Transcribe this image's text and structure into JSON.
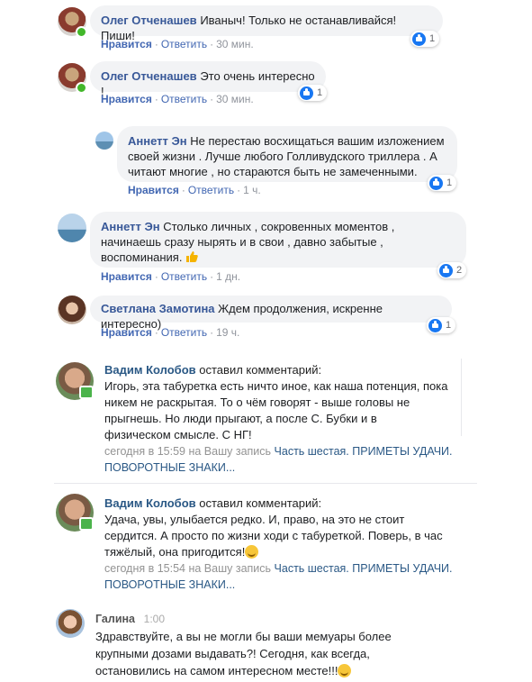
{
  "comments": [
    {
      "author": "Олег Отченашев",
      "text": "Иваныч! Только не останавливайся! Пиши!",
      "like_label": "Нравится",
      "reply_label": "Ответить",
      "time": "30 мин.",
      "likes": "1"
    },
    {
      "author": "Олег Отченашев",
      "text": "Это очень интересно !",
      "like_label": "Нравится",
      "reply_label": "Ответить",
      "time": "30 мин.",
      "likes": "1"
    },
    {
      "author": "Аннетт Эн",
      "line1": "Не перестаю восхищаться вашим изложением",
      "line2": "своей жизни . Лучше любого Голливудского триллера . А",
      "line3": "читают многие , но стараются быть не замеченными.",
      "like_label": "Нравится",
      "reply_label": "Ответить",
      "time": "1 ч.",
      "likes": "1"
    },
    {
      "author": "Аннетт Эн",
      "line1": "Столько личных , сокровенных моментов ,",
      "line2": "начинаешь сразу нырять и в свои , давно забытые ,",
      "line3": "воспоминания.",
      "like_label": "Нравится",
      "reply_label": "Ответить",
      "time": "1 дн.",
      "likes": "2"
    },
    {
      "author": "Светлана Замотина",
      "text": "Ждем продолжения, искренне интересно)",
      "like_label": "Нравится",
      "reply_label": "Ответить",
      "time": "19 ч.",
      "likes": "1"
    }
  ],
  "vk_comments": [
    {
      "author": "Вадим Колобов",
      "action": "оставил комментарий:",
      "line1": "Игорь, эта табуретка есть ничто иное, как наша потенция, пока",
      "line2": "никем не раскрытая. То о чём говорят - выше головы не",
      "line3": "прыгнешь. Но люди прыгают, а после С. Бубки и в",
      "line4": "физическом смысле. С НГ!",
      "footer_prefix": "сегодня в 15:59 на Вашу запись",
      "footer_link1": "Часть шестая. ПРИМЕТЫ УДАЧИ.",
      "footer_link2": "ПОВОРОТНЫЕ ЗНАКИ..."
    },
    {
      "author": "Вадим Колобов",
      "action": "оставил комментарий:",
      "line1": "Удача, увы, улыбается редко. И, право, на это не стоит",
      "line2": "сердится. А просто по жизни ходи с табуреткой. Поверь, в час",
      "line3": "тяжёлый, она пригодится!",
      "footer_prefix": "сегодня в 15:54 на Вашу запись",
      "footer_link1": "Часть шестая. ПРИМЕТЫ УДАЧИ.",
      "footer_link2": "ПОВОРОТНЫЕ ЗНАКИ..."
    }
  ],
  "ok_comment": {
    "author": "Галина",
    "time": "1:00",
    "line1": "Здравствуйте, а вы не могли бы ваши мемуары более",
    "line2": "крупными дозами выдавать?! Сегодня, как всегда,",
    "line3": "остановились на самом интересном месте!!!"
  },
  "colors": {
    "fb_link": "#385898",
    "vk_link": "#2a5885",
    "bubble_bg": "#f2f3f5",
    "like_blue": "#1877f2",
    "online_green": "#42b72a"
  }
}
